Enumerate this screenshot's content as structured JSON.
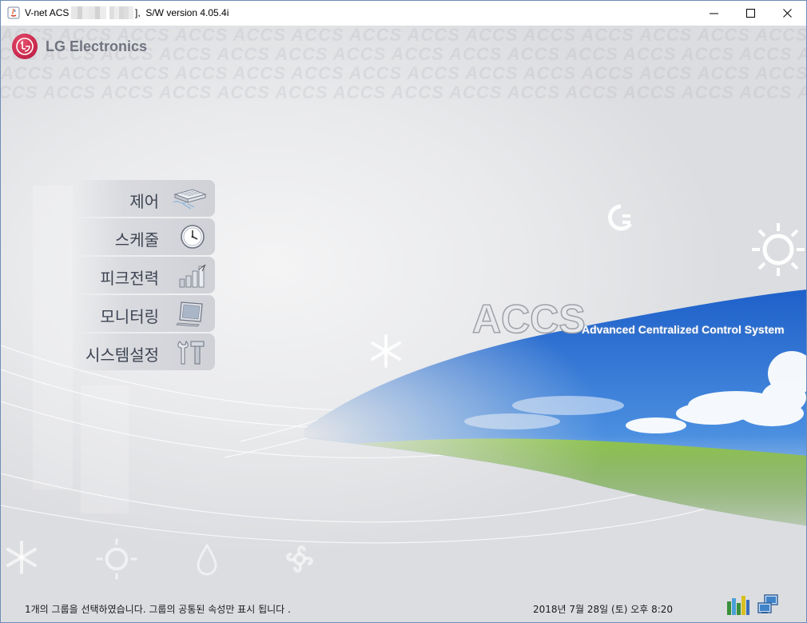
{
  "window": {
    "title_prefix": "V-net ACS",
    "title_suffix": "],  S/W version 4.05.4i",
    "minimize_glyph": "—",
    "maximize_glyph": "☐",
    "close_glyph": "✕"
  },
  "brand": {
    "company": "LG Electronics",
    "product": "ACCS",
    "product_full": "Advanced Centralized Control System",
    "watermark": "ACCS"
  },
  "menu": {
    "items": [
      {
        "label": "제어",
        "icon": "air-conditioner-icon"
      },
      {
        "label": "스케줄",
        "icon": "clock-icon"
      },
      {
        "label": "피크전력",
        "icon": "bar-graph-icon"
      },
      {
        "label": "모니터링",
        "icon": "monitor-icon"
      },
      {
        "label": "시스템설정",
        "icon": "tools-icon"
      }
    ]
  },
  "status_bar": {
    "message": "1개의 그룹을 선택하였습니다. 그룹의 공통된 속성만 표시 됩니다 .",
    "datetime": "2018년 7월 28일 (토) 오후 8:20",
    "icons": [
      "peak-power-status-icon",
      "network-status-icon"
    ]
  },
  "colors": {
    "lg_red": "#b4123a",
    "menu_text": "#3d4452",
    "sky_blue": "#2f78d6",
    "grass_green": "#5c9a2a"
  }
}
